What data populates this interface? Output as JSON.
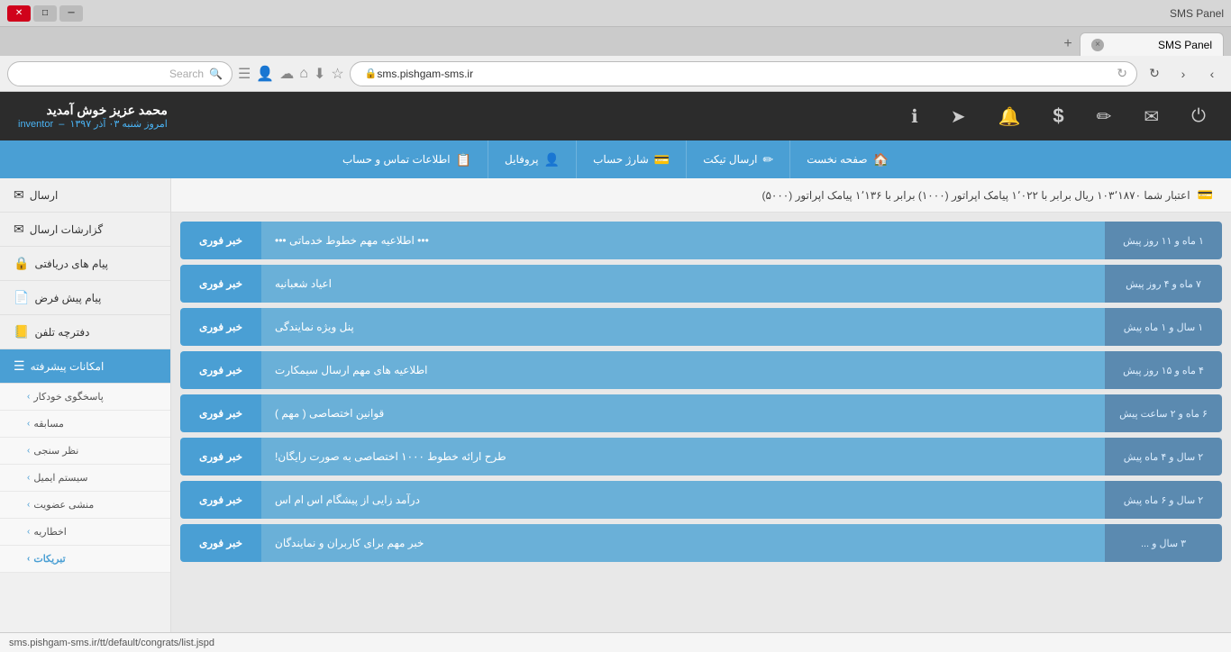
{
  "browser": {
    "titlebar_title": "SMS Panel",
    "minimize_label": "─",
    "maximize_label": "□",
    "close_label": "✕",
    "tab_label": "SMS Panel",
    "tab_close": "×",
    "new_tab": "+",
    "address": "sms.pishgam-sms.ir",
    "search_placeholder": "Search",
    "nav_back": "‹",
    "nav_forward": "›",
    "nav_refresh": "↻",
    "nav_home": "⌂"
  },
  "topnav": {
    "icons": [
      {
        "name": "power-icon",
        "symbol": "⏻"
      },
      {
        "name": "mail-icon",
        "symbol": "✉"
      },
      {
        "name": "edit-icon",
        "symbol": "✏"
      },
      {
        "name": "dollar-icon",
        "symbol": "$"
      },
      {
        "name": "bell-icon",
        "symbol": "🔔"
      },
      {
        "name": "send-icon",
        "symbol": "➤"
      },
      {
        "name": "info-icon",
        "symbol": "ℹ"
      }
    ],
    "user_name": "محمد عزیز خوش آمدید",
    "user_role": "inventor",
    "user_date": "امروز شنبه ۰۳ آذر ۱۳۹۷"
  },
  "menubar": {
    "items": [
      {
        "label": "صفحه نخست",
        "icon": "🏠"
      },
      {
        "label": "ارسال تیکت",
        "icon": "✏"
      },
      {
        "label": "شارژ حساب",
        "icon": "💳"
      },
      {
        "label": "پروفایل",
        "icon": "👤"
      },
      {
        "label": "اطلاعات تماس و حساب",
        "icon": "📋"
      }
    ]
  },
  "credit_bar": {
    "icon": "💳",
    "text": "اعتبار شما ۱۰۳٬۱۸۷۰ ریال برابر با ۱٬۰۲۲ پیامک اپراتور (۱۰۰۰) برابر با ۱٬۱۳۶ پیامک اپراتور (۵۰۰۰)"
  },
  "sidebar": {
    "items": [
      {
        "label": "ارسال",
        "icon": "✉",
        "active": false,
        "name": "sidebar-item-send"
      },
      {
        "label": "گزارشات ارسال",
        "icon": "✉",
        "active": false,
        "name": "sidebar-item-reports"
      },
      {
        "label": "پیام های دریافتی",
        "icon": "🔒",
        "active": false,
        "name": "sidebar-item-inbox"
      },
      {
        "label": "پیام پیش فرض",
        "icon": "📄",
        "active": false,
        "name": "sidebar-item-default"
      },
      {
        "label": "دفترچه تلفن",
        "icon": "📒",
        "active": false,
        "name": "sidebar-item-phonebook"
      },
      {
        "label": "امکانات پیشرفته",
        "icon": "☰",
        "active": true,
        "name": "sidebar-item-advanced"
      }
    ],
    "sub_items": [
      {
        "label": "پاسخگوی خودکار",
        "name": "sidebar-sub-autoresponder"
      },
      {
        "label": "مسابقه",
        "name": "sidebar-sub-contest"
      },
      {
        "label": "نظر سنجی",
        "name": "sidebar-sub-survey"
      },
      {
        "label": "سیستم ایمیل",
        "name": "sidebar-sub-email"
      },
      {
        "label": "منشی عضویت",
        "name": "sidebar-sub-membership"
      },
      {
        "label": "اخطاریه",
        "name": "sidebar-sub-alert"
      },
      {
        "label": "تبریکات",
        "name": "sidebar-sub-congratulations"
      }
    ]
  },
  "news": {
    "items": [
      {
        "tag": "خبر فوری",
        "title": "••• اطلاعیه مهم خطوط خدماتی •••",
        "date": "۱ ماه و ۱۱ روز پیش"
      },
      {
        "tag": "خبر فوری",
        "title": "اعیاد شعبانیه",
        "date": "۷ ماه و ۴ روز پیش"
      },
      {
        "tag": "خبر فوری",
        "title": "پنل ویژه نمایندگی",
        "date": "۱ سال و ۱ ماه پیش"
      },
      {
        "tag": "خبر فوری",
        "title": "اطلاعیه های مهم ارسال سیمکارت",
        "date": "۴ ماه و ۱۵ روز پیش"
      },
      {
        "tag": "خبر فوری",
        "title": "قوانین اختصاصی ( مهم )",
        "date": "۶ ماه و ۲ ساعت پیش"
      },
      {
        "tag": "خبر فوری",
        "title": "طرح ارائه خطوط ۱۰۰۰ اختصاصی به صورت رایگان!",
        "date": "۲ سال و ۴ ماه پیش"
      },
      {
        "tag": "خبر فوری",
        "title": "درآمد زایی از پیشگام اس ام اس",
        "date": "۲ سال و ۶ ماه پیش"
      },
      {
        "tag": "خبر فوری",
        "title": "خبر مهم برای کاربران و نمایندگان",
        "date": "۳ سال و ..."
      }
    ]
  },
  "status_bar": {
    "url": "sms.pishgam-sms.ir/tt/default/congrats/list.jspd"
  }
}
